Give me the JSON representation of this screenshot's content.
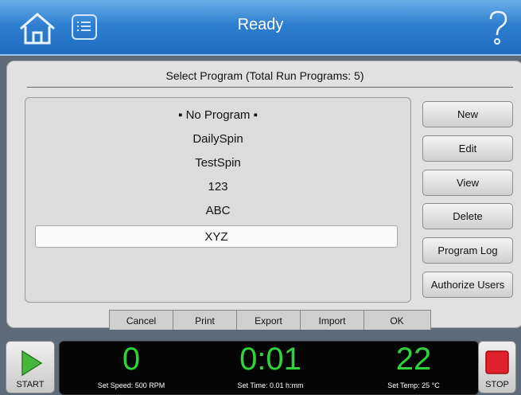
{
  "header": {
    "title": "Ready"
  },
  "panel": {
    "title": "Select Program (Total Run Programs: 5)",
    "programs": [
      "▪ No Program ▪",
      "DailySpin",
      "TestSpin",
      "123",
      "ABC",
      "XYZ"
    ],
    "selected": "XYZ"
  },
  "side_buttons": [
    "New",
    "Edit",
    "View",
    "Delete",
    "Program Log",
    "Authorize Users"
  ],
  "tabs": [
    "Cancel",
    "Print",
    "Export",
    "Import",
    "OK"
  ],
  "status": {
    "start_label": "START",
    "stop_label": "STOP",
    "speed": "0",
    "speed_set": "Set Speed: 500 RPM",
    "time": "0:01",
    "time_set": "Set Time: 0.01 h:mm",
    "temp": "22",
    "temp_set": "Set Temp: 25 °C"
  },
  "colors": {
    "accent": "#2f7fd0",
    "readout": "#2fd33a",
    "stop": "#e0202a",
    "start": "#46b83a"
  }
}
